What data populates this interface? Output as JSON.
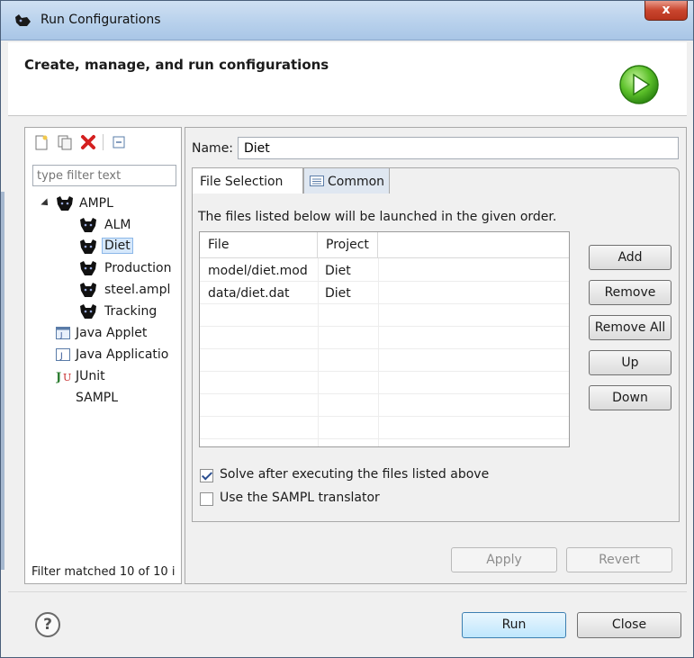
{
  "window": {
    "title": "Run Configurations",
    "close_glyph": "x"
  },
  "header": {
    "title": "Create, manage, and run configurations",
    "icon": "run-play-icon"
  },
  "left": {
    "toolbar": [
      "new-config-icon",
      "duplicate-icon",
      "delete-icon",
      "collapse-all-icon"
    ],
    "filter_placeholder": "type filter text",
    "tree": [
      {
        "label": "AMPL",
        "icon": "ampl-cat-icon"
      },
      {
        "label": "ALM",
        "icon": "ampl-cat-icon"
      },
      {
        "label": "Diet",
        "icon": "ampl-cat-icon",
        "selected": true
      },
      {
        "label": "Production",
        "icon": "ampl-cat-icon"
      },
      {
        "label": "steel.ampl",
        "icon": "ampl-cat-icon"
      },
      {
        "label": "Tracking",
        "icon": "ampl-cat-icon"
      },
      {
        "label": "Java Applet",
        "icon": "java-applet-icon"
      },
      {
        "label": "Java Applicatio",
        "icon": "java-application-icon"
      },
      {
        "label": "JUnit",
        "icon": "junit-icon"
      },
      {
        "label": "SAMPL",
        "icon": ""
      }
    ],
    "footer": "Filter matched 10 of 10 i"
  },
  "right": {
    "name_label": "Name:",
    "name_value": "Diet",
    "tabs": [
      {
        "label": "File Selection",
        "active": true
      },
      {
        "label": "Common",
        "active": false
      }
    ],
    "description": "The files listed below will be launched in the given order.",
    "table": {
      "columns": [
        "File",
        "Project"
      ],
      "rows": [
        [
          "model/diet.mod",
          "Diet"
        ],
        [
          "data/diet.dat",
          "Diet"
        ]
      ]
    },
    "side_buttons": [
      "Add",
      "Remove",
      "Remove All",
      "Up",
      "Down"
    ],
    "checkboxes": [
      {
        "label": "Solve after executing the files listed above",
        "checked": true
      },
      {
        "label": "Use the SAMPL translator",
        "checked": false
      }
    ],
    "apply_label": "Apply",
    "revert_label": "Revert"
  },
  "footer": {
    "run_label": "Run",
    "close_label": "Close",
    "help_glyph": "?"
  }
}
